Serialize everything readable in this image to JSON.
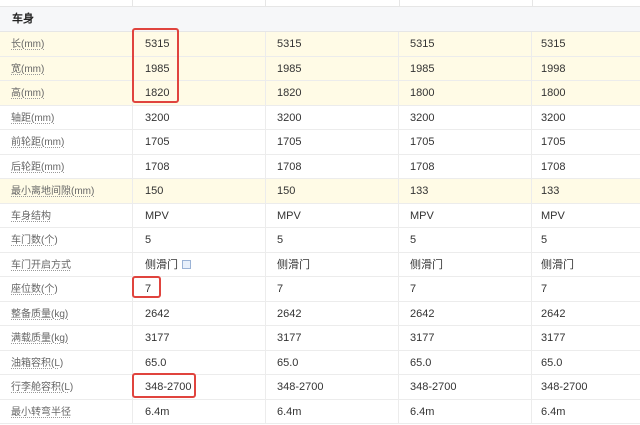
{
  "section": {
    "title": "车身"
  },
  "rows": [
    {
      "label": "长(mm)",
      "values": [
        "5315",
        "5315",
        "5315",
        "5315"
      ],
      "highlight": true
    },
    {
      "label": "宽(mm)",
      "values": [
        "1985",
        "1985",
        "1985",
        "1998"
      ],
      "highlight": true
    },
    {
      "label": "高(mm)",
      "values": [
        "1820",
        "1820",
        "1800",
        "1800"
      ],
      "highlight": true
    },
    {
      "label": "轴距(mm)",
      "values": [
        "3200",
        "3200",
        "3200",
        "3200"
      ],
      "highlight": false
    },
    {
      "label": "前轮距(mm)",
      "values": [
        "1705",
        "1705",
        "1705",
        "1705"
      ],
      "highlight": false
    },
    {
      "label": "后轮距(mm)",
      "values": [
        "1708",
        "1708",
        "1708",
        "1708"
      ],
      "highlight": false
    },
    {
      "label": "最小离地间隙(mm)",
      "values": [
        "150",
        "150",
        "133",
        "133"
      ],
      "highlight": true
    },
    {
      "label": "车身结构",
      "values": [
        "MPV",
        "MPV",
        "MPV",
        "MPV"
      ],
      "highlight": false
    },
    {
      "label": "车门数(个)",
      "values": [
        "5",
        "5",
        "5",
        "5"
      ],
      "highlight": false
    },
    {
      "label": "车门开启方式",
      "values": [
        "侧滑门",
        "侧滑门",
        "侧滑门",
        "侧滑门"
      ],
      "highlight": false
    },
    {
      "label": "座位数(个)",
      "values": [
        "7",
        "7",
        "7",
        "7"
      ],
      "highlight": false
    },
    {
      "label": "整备质量(kg)",
      "values": [
        "2642",
        "2642",
        "2642",
        "2642"
      ],
      "highlight": false
    },
    {
      "label": "满载质量(kg)",
      "values": [
        "3177",
        "3177",
        "3177",
        "3177"
      ],
      "highlight": false
    },
    {
      "label": "油箱容积(L)",
      "values": [
        "65.0",
        "65.0",
        "65.0",
        "65.0"
      ],
      "highlight": false
    },
    {
      "label": "行李舱容积(L)",
      "values": [
        "348-2700",
        "348-2700",
        "348-2700",
        "348-2700"
      ],
      "highlight": false
    },
    {
      "label": "最小转弯半径",
      "values": [
        "6.4m",
        "6.4m",
        "6.4m",
        "6.4m"
      ],
      "highlight": false
    }
  ],
  "colors": {
    "highlight_row": "#fffbe6",
    "annotation": "#e0443e",
    "info_icon": "#9bb3d6"
  },
  "icons": {
    "door_info": "info-icon"
  }
}
